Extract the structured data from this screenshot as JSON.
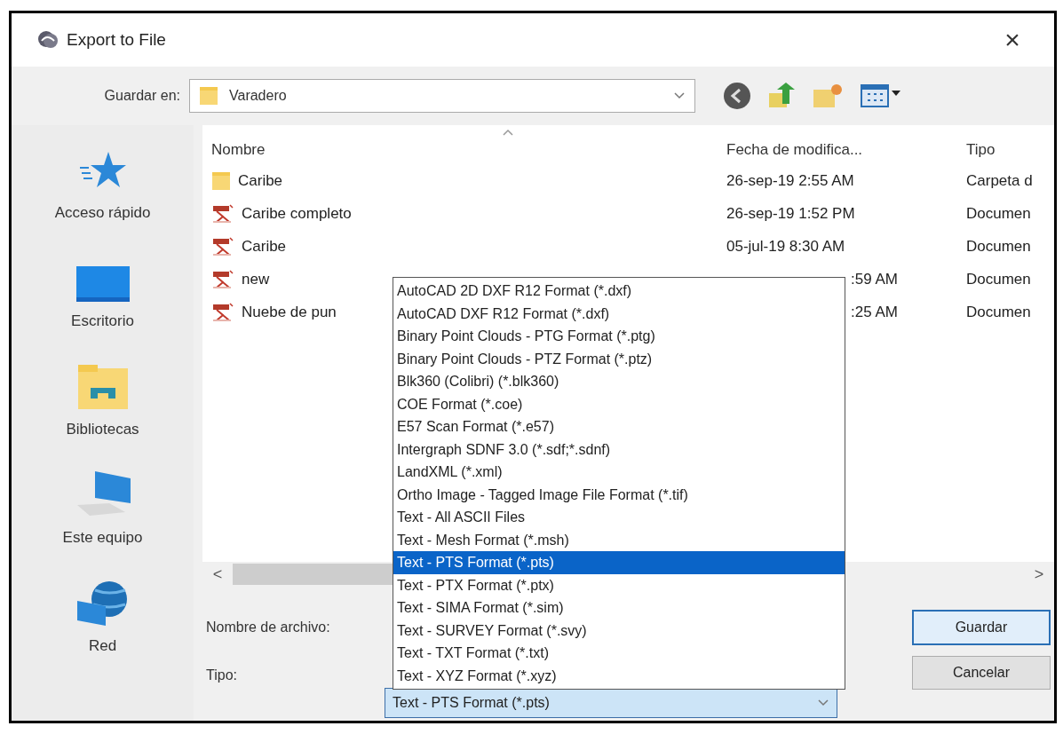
{
  "window": {
    "title": "Export to File",
    "close": "×"
  },
  "location": {
    "label": "Guardar en:",
    "value": "Varadero"
  },
  "sidebar": {
    "items": [
      {
        "label": "Acceso rápido",
        "kind": "star"
      },
      {
        "label": "Escritorio",
        "kind": "desktop"
      },
      {
        "label": "Bibliotecas",
        "kind": "library"
      },
      {
        "label": "Este equipo",
        "kind": "computer"
      },
      {
        "label": "Red",
        "kind": "network"
      }
    ]
  },
  "file_list": {
    "columns": [
      "Nombre",
      "Fecha de modifica...",
      "Tipo"
    ],
    "rows": [
      {
        "name": "Caribe",
        "date": "26-sep-19 2:55 AM",
        "type": "Carpeta d",
        "kind": "folder"
      },
      {
        "name": "Caribe completo",
        "date": "26-sep-19 1:52 PM",
        "type": "Documen",
        "kind": "pdf"
      },
      {
        "name": "Caribe",
        "date": "05-jul-19 8:30 AM",
        "type": "Documen",
        "kind": "pdf"
      },
      {
        "name": "new",
        "date": ":59 AM",
        "type": "Documen",
        "kind": "pdf"
      },
      {
        "name": "Nuebe de pun",
        "date": ":25 AM",
        "type": "Documen",
        "kind": "pdf"
      }
    ],
    "scroll_left": "<",
    "scroll_right": ">"
  },
  "file_name": {
    "label": "Nombre de archivo:"
  },
  "file_type": {
    "label": "Tipo:",
    "value": "Text - PTS Format (*.pts)",
    "options": [
      {
        "label": "AutoCAD 2D DXF R12 Format (*.dxf)",
        "selected": false
      },
      {
        "label": "AutoCAD DXF R12 Format (*.dxf)",
        "selected": false
      },
      {
        "label": "Binary Point Clouds - PTG Format (*.ptg)",
        "selected": false
      },
      {
        "label": "Binary Point Clouds - PTZ Format (*.ptz)",
        "selected": false
      },
      {
        "label": "Blk360 (Colibri) (*.blk360)",
        "selected": false
      },
      {
        "label": "COE Format (*.coe)",
        "selected": false
      },
      {
        "label": "E57 Scan Format (*.e57)",
        "selected": false
      },
      {
        "label": "Intergraph SDNF 3.0 (*.sdf;*.sdnf)",
        "selected": false
      },
      {
        "label": "LandXML (*.xml)",
        "selected": false
      },
      {
        "label": "Ortho Image - Tagged Image File Format (*.tif)",
        "selected": false
      },
      {
        "label": "Text - All ASCII Files",
        "selected": false
      },
      {
        "label": "Text - Mesh Format (*.msh)",
        "selected": false
      },
      {
        "label": "Text - PTS Format (*.pts)",
        "selected": true
      },
      {
        "label": "Text - PTX Format (*.ptx)",
        "selected": false
      },
      {
        "label": "Text - SIMA Format (*.sim)",
        "selected": false
      },
      {
        "label": "Text - SURVEY Format (*.svy)",
        "selected": false
      },
      {
        "label": "Text - TXT Format (*.txt)",
        "selected": false
      },
      {
        "label": "Text - XYZ Format (*.xyz)",
        "selected": false
      }
    ]
  },
  "buttons": [
    {
      "label": "Guardar",
      "kind": "default"
    },
    {
      "label": "Cancelar",
      "kind": "normal"
    }
  ]
}
